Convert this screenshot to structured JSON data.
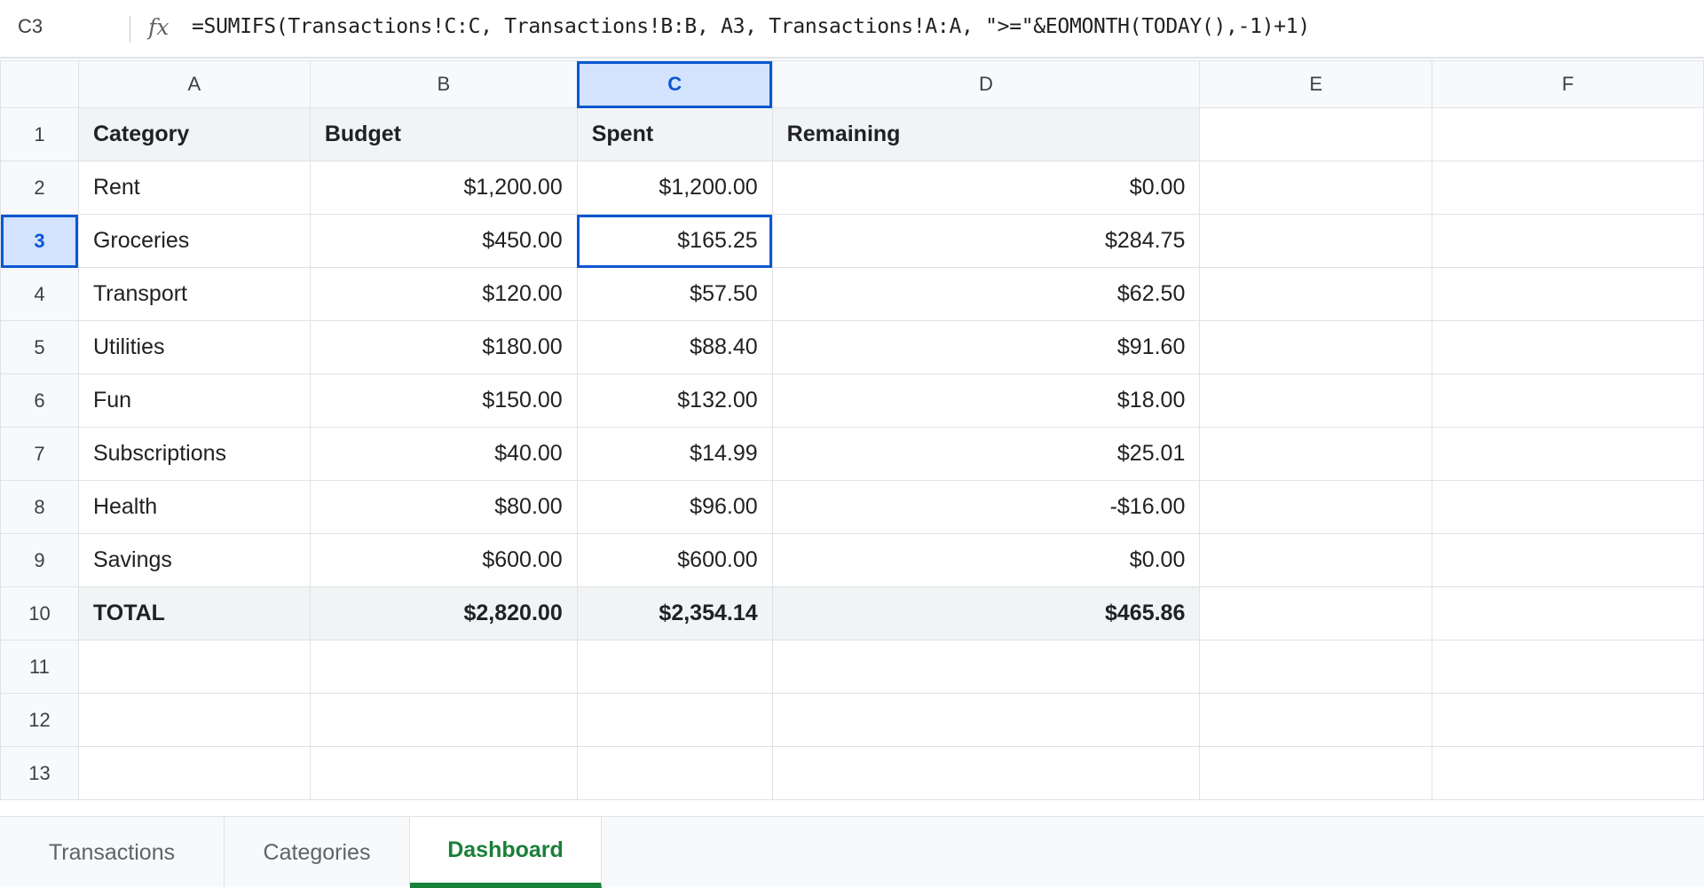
{
  "formula_bar": {
    "cell_ref": "C3",
    "fx_label": "fx",
    "formula": "=SUMIFS(Transactions!C:C, Transactions!B:B, A3, Transactions!A:A, \">=\"&EOMONTH(TODAY(),-1)+1)"
  },
  "columns": [
    "A",
    "B",
    "C",
    "D",
    "E",
    "F"
  ],
  "rows": [
    {
      "num": "1",
      "a": "Category",
      "b": "Budget",
      "c": "Spent",
      "d": "Remaining"
    },
    {
      "num": "2",
      "a": "Rent",
      "b": "$1,200.00",
      "c": "$1,200.00",
      "d": "$0.00"
    },
    {
      "num": "3",
      "a": "Groceries",
      "b": "$450.00",
      "c": "$165.25",
      "d": "$284.75"
    },
    {
      "num": "4",
      "a": "Transport",
      "b": "$120.00",
      "c": "$57.50",
      "d": "$62.50"
    },
    {
      "num": "5",
      "a": "Utilities",
      "b": "$180.00",
      "c": "$88.40",
      "d": "$91.60"
    },
    {
      "num": "6",
      "a": "Fun",
      "b": "$150.00",
      "c": "$132.00",
      "d": "$18.00"
    },
    {
      "num": "7",
      "a": "Subscriptions",
      "b": "$40.00",
      "c": "$14.99",
      "d": "$25.01"
    },
    {
      "num": "8",
      "a": "Health",
      "b": "$80.00",
      "c": "$96.00",
      "d": "-$16.00"
    },
    {
      "num": "9",
      "a": "Savings",
      "b": "$600.00",
      "c": "$600.00",
      "d": "$0.00"
    },
    {
      "num": "10",
      "a": "TOTAL",
      "b": "$2,820.00",
      "c": "$2,354.14",
      "d": "$465.86"
    },
    {
      "num": "11",
      "a": "",
      "b": "",
      "c": "",
      "d": ""
    },
    {
      "num": "12",
      "a": "",
      "b": "",
      "c": "",
      "d": ""
    },
    {
      "num": "13",
      "a": "",
      "b": "",
      "c": "",
      "d": ""
    }
  ],
  "selection": {
    "column": "C",
    "row": "3"
  },
  "sheet_tabs": [
    "Transactions",
    "Categories",
    "Dashboard"
  ],
  "active_tab": "Dashboard",
  "colors": {
    "selection": "#0b57d0",
    "selection_fill": "#d3e3fd",
    "active_tab": "#188038"
  }
}
